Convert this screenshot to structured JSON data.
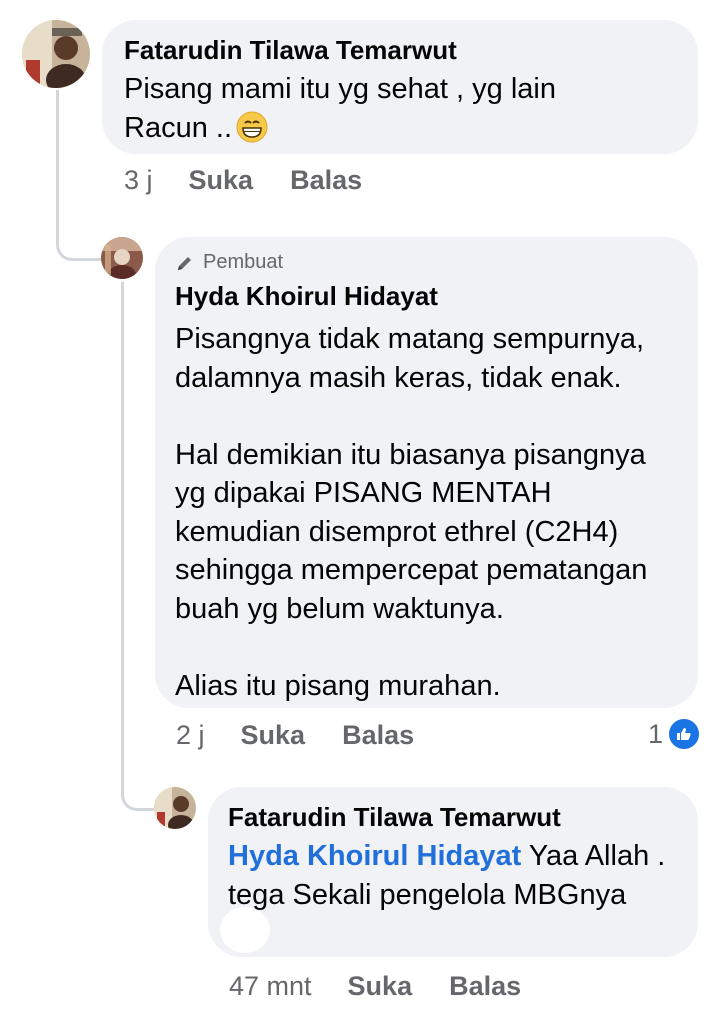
{
  "comments": [
    {
      "author": "Fatarudin Tilawa Temarwut",
      "text": "Pisang mami itu yg sehat , yg lain\nRacun ..",
      "emoji": "grinning-face-icon",
      "time": "3 j",
      "like_label": "Suka",
      "reply_label": "Balas"
    },
    {
      "badge": "Pembuat",
      "author": "Hyda Khoirul Hidayat",
      "text": "Pisangnya tidak matang sempurnya,\ndalamnya masih keras, tidak enak.\n\nHal demikian itu biasanya pisangnya\nyg dipakai PISANG MENTAH\nkemudian disemprot ethrel (C2H4)\nsehingga mempercepat pematangan\nbuah yg belum waktunya.\n\nAlias itu pisang murahan.",
      "time": "2 j",
      "like_label": "Suka",
      "reply_label": "Balas",
      "reaction_count": "1",
      "reaction_icon": "like-icon"
    },
    {
      "author": "Fatarudin Tilawa Temarwut",
      "mention": "Hyda Khoirul Hidayat",
      "text_after_mention": " Yaa Allah .\ntega Sekali pengelola MBGnya",
      "time": "47 mnt",
      "like_label": "Suka",
      "reply_label": "Balas"
    }
  ],
  "colors": {
    "bubble": "#f0f2f5",
    "meta_text": "#65676b",
    "mention": "#216fdb",
    "like_blue": "#1b74e4",
    "thread_line": "#d3d6db"
  }
}
